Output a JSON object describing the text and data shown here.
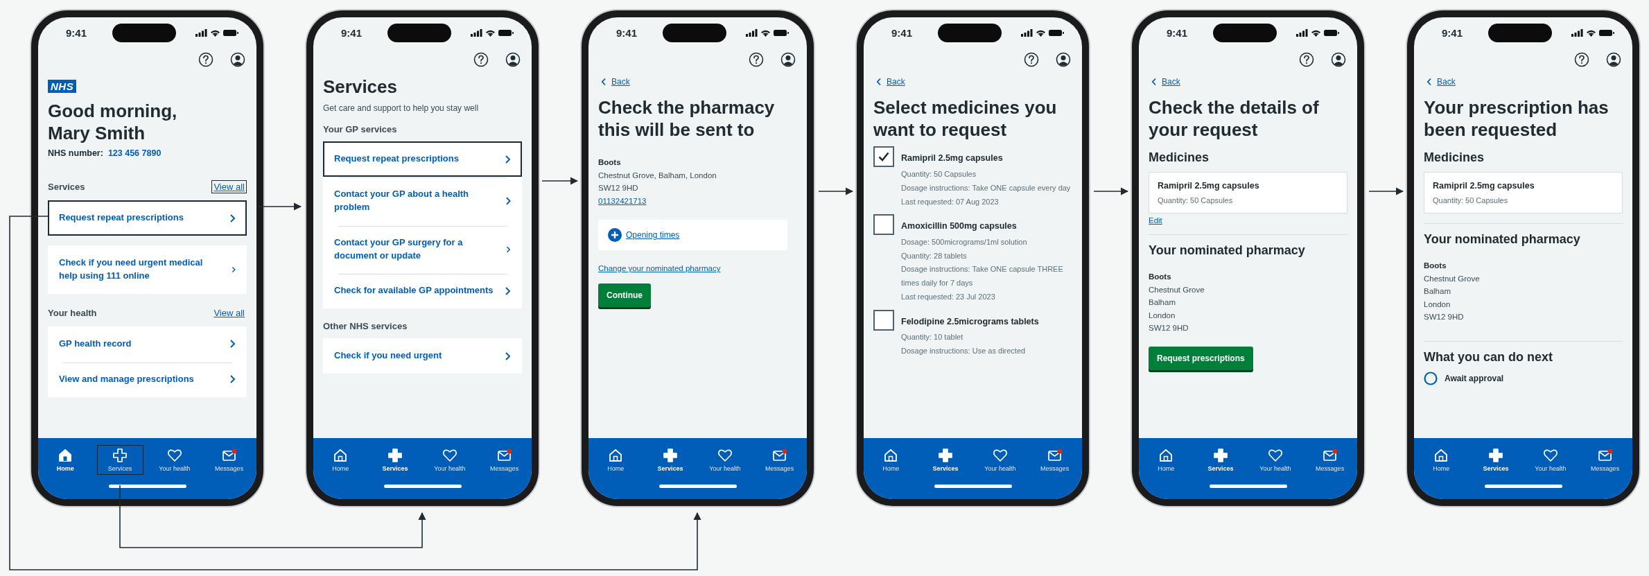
{
  "screens": [
    {
      "time": "9:41",
      "nav": [
        {
          "label": "Home",
          "selected": true,
          "outlined": false
        },
        {
          "label": "Services",
          "selected": false,
          "outlined": true
        },
        {
          "label": "Your health",
          "selected": false,
          "outlined": false
        },
        {
          "label": "Messages",
          "selected": false,
          "outlined": false
        }
      ],
      "blocks": [
        {
          "kind": "logo",
          "text": "NHS"
        },
        {
          "kind": "greeting",
          "text": "Good morning, Mary Smith"
        },
        {
          "kind": "nhs_number",
          "label": "NHS number:",
          "value": "123 456 7890"
        },
        {
          "kind": "section",
          "text": "Services",
          "link": "View all",
          "outlined": true
        },
        {
          "kind": "cards",
          "items": [
            {
              "label": "Request repeat prescriptions",
              "outlined": true
            }
          ]
        },
        {
          "kind": "cards",
          "items": [
            {
              "label": "Check if you need urgent medical help using 111 online",
              "outlined": false
            }
          ]
        },
        {
          "kind": "section",
          "text": "Your health",
          "link": "View all",
          "outlined": false
        },
        {
          "kind": "cards",
          "items": [
            {
              "label": "GP health record",
              "outlined": false
            },
            {
              "label": "View and manage prescriptions",
              "outlined": false
            }
          ]
        }
      ]
    },
    {
      "time": "9:41",
      "nav": [
        {
          "label": "Home",
          "selected": false,
          "outlined": false
        },
        {
          "label": "Services",
          "selected": true,
          "outlined": false
        },
        {
          "label": "Your health",
          "selected": false,
          "outlined": false
        },
        {
          "label": "Messages",
          "selected": false,
          "outlined": false
        }
      ],
      "blocks": [
        {
          "kind": "title",
          "text": "Services"
        },
        {
          "kind": "subtitle",
          "text": "Get care and support to help you stay well"
        },
        {
          "kind": "section",
          "text": "Your GP services"
        },
        {
          "kind": "cards",
          "items": [
            {
              "label": "Request repeat prescriptions",
              "outlined": true
            },
            {
              "label": "Contact your GP about a health problem",
              "outlined": false
            },
            {
              "label": "Contact your GP surgery for a document or update",
              "outlined": false
            },
            {
              "label": "Check for available GP appointments",
              "outlined": false
            }
          ]
        },
        {
          "kind": "section",
          "text": "Other NHS services"
        },
        {
          "kind": "cards",
          "items": [
            {
              "label": "Check if you need urgent",
              "outlined": false
            }
          ]
        }
      ]
    },
    {
      "time": "9:41",
      "nav": [
        {
          "label": "Home",
          "selected": false,
          "outlined": false
        },
        {
          "label": "Services",
          "selected": true,
          "outlined": false
        },
        {
          "label": "Your health",
          "selected": false,
          "outlined": false
        },
        {
          "label": "Messages",
          "selected": false,
          "outlined": false
        }
      ],
      "blocks": [
        {
          "kind": "back",
          "text": "Back"
        },
        {
          "kind": "title",
          "text": "Check the pharmacy this will be sent to"
        },
        {
          "kind": "address",
          "name": "Boots",
          "lines": [
            "Chestnut Grove, Balham, London",
            "SW12 9HD"
          ],
          "phone": "01132421713"
        },
        {
          "kind": "expander",
          "text": "Opening times"
        },
        {
          "kind": "link",
          "text": "Change your nominated pharmacy"
        },
        {
          "kind": "button",
          "text": "Continue"
        }
      ]
    },
    {
      "time": "9:41",
      "nav": [
        {
          "label": "Home",
          "selected": false,
          "outlined": false
        },
        {
          "label": "Services",
          "selected": true,
          "outlined": false
        },
        {
          "label": "Your health",
          "selected": false,
          "outlined": false
        },
        {
          "label": "Messages",
          "selected": false,
          "outlined": false
        }
      ],
      "blocks": [
        {
          "kind": "back",
          "text": "Back"
        },
        {
          "kind": "title",
          "text": "Select medicines you want to request"
        },
        {
          "kind": "checkbox",
          "name": "Ramipril 2.5mg capsules",
          "checked": true,
          "details": [
            "Quantity: 50 Capsules",
            "Dosage instructions: Take ONE capsule every day",
            "Last requested: 07 Aug 2023"
          ]
        },
        {
          "kind": "checkbox",
          "name": "Amoxicillin 500mg capsules",
          "checked": false,
          "details": [
            "Dosage: 500micrograms/1ml solution",
            "Quantity: 28 tablets",
            "Dosage instructions: Take ONE capsule THREE times daily for 7 days",
            "Last requested: 23 Jul 2023"
          ]
        },
        {
          "kind": "checkbox",
          "name": "Felodipine 2.5micrograms tablets",
          "checked": false,
          "details": [
            "Quantity: 10 tablet",
            "Dosage instructions: Use as directed"
          ]
        }
      ]
    },
    {
      "time": "9:41",
      "nav": [
        {
          "label": "Home",
          "selected": false,
          "outlined": false
        },
        {
          "label": "Services",
          "selected": true,
          "outlined": false
        },
        {
          "label": "Your health",
          "selected": false,
          "outlined": false
        },
        {
          "label": "Messages",
          "selected": false,
          "outlined": false
        }
      ],
      "blocks": [
        {
          "kind": "back",
          "text": "Back"
        },
        {
          "kind": "title",
          "text": "Check the details of your request"
        },
        {
          "kind": "heading",
          "text": "Medicines"
        },
        {
          "kind": "summary",
          "name": "Ramipril 2.5mg capsules",
          "detail": "Quantity: 50 Capsules"
        },
        {
          "kind": "edit",
          "text": "Edit"
        },
        {
          "kind": "divider"
        },
        {
          "kind": "heading",
          "text": "Your nominated pharmacy"
        },
        {
          "kind": "address",
          "name": "Boots",
          "lines": [
            "Chestnut Grove",
            "Balham",
            "London",
            "SW12 9HD"
          ]
        },
        {
          "kind": "button",
          "text": "Request prescriptions"
        }
      ]
    },
    {
      "time": "9:41",
      "nav": [
        {
          "label": "Home",
          "selected": false,
          "outlined": false
        },
        {
          "label": "Services",
          "selected": true,
          "outlined": false
        },
        {
          "label": "Your health",
          "selected": false,
          "outlined": false
        },
        {
          "label": "Messages",
          "selected": false,
          "outlined": false
        }
      ],
      "blocks": [
        {
          "kind": "back",
          "text": "Back"
        },
        {
          "kind": "title",
          "text": "Your prescription has been requested"
        },
        {
          "kind": "heading",
          "text": "Medicines"
        },
        {
          "kind": "summary",
          "name": "Ramipril 2.5mg capsules",
          "detail": "Quantity: 50 Capsules"
        },
        {
          "kind": "divider"
        },
        {
          "kind": "heading",
          "text": "Your nominated pharmacy"
        },
        {
          "kind": "address",
          "name": "Boots",
          "lines": [
            "Chestnut Grove",
            "Balham",
            "London",
            "SW12 9HD"
          ]
        },
        {
          "kind": "divider"
        },
        {
          "kind": "heading",
          "text": "What you can do next"
        },
        {
          "kind": "step",
          "text": "Await approval"
        }
      ]
    }
  ]
}
